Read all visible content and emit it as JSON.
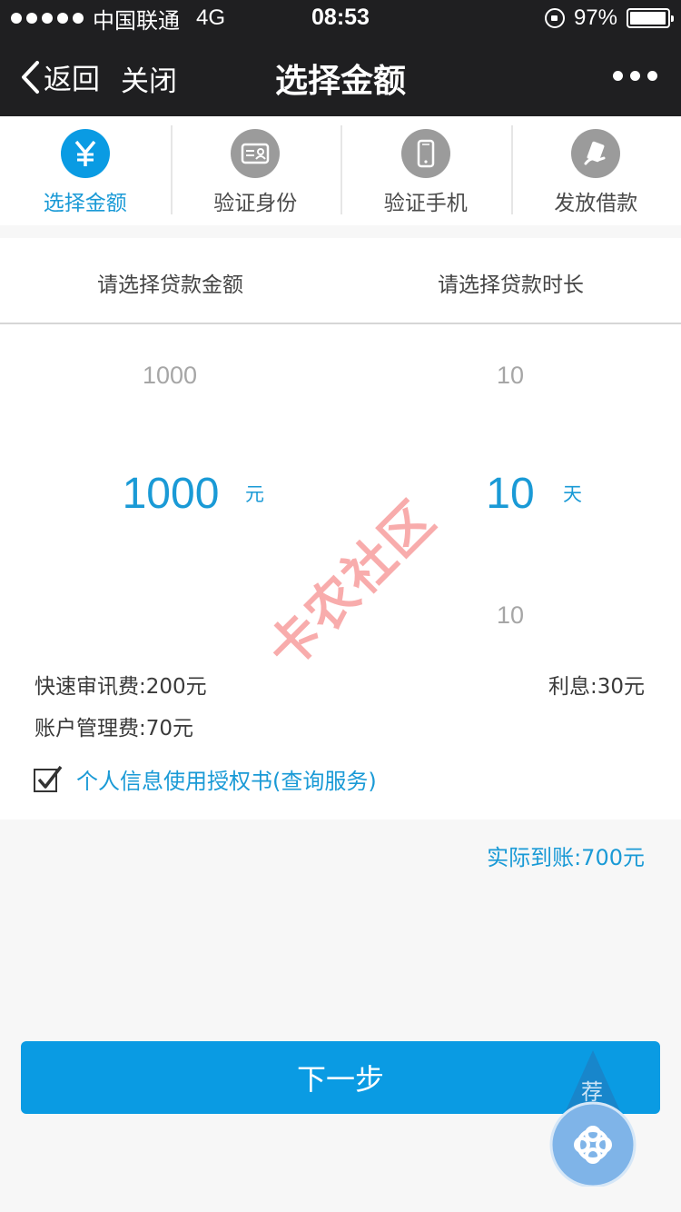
{
  "status_bar": {
    "carrier": "中国联通",
    "network": "4G",
    "time": "08:53",
    "battery": "97%",
    "battery_level": 0.97
  },
  "nav": {
    "back_label": "返回",
    "close_label": "关闭",
    "title": "选择金额"
  },
  "steps": [
    {
      "label": "选择金额",
      "icon": "yuan-icon",
      "active": true
    },
    {
      "label": "验证身份",
      "icon": "id-card-icon",
      "active": false
    },
    {
      "label": "验证手机",
      "icon": "phone-icon",
      "active": false
    },
    {
      "label": "发放借款",
      "icon": "money-icon",
      "active": false
    }
  ],
  "amount_picker": {
    "header": "请选择贷款金额",
    "above": "1000",
    "selected": "1000",
    "unit": "元"
  },
  "term_picker": {
    "header": "请选择贷款时长",
    "above": "10",
    "selected": "10",
    "unit": "天",
    "below": "10"
  },
  "fees": {
    "review_fee": "快速审讯费:200元",
    "account_fee": "账户管理费:70元",
    "interest": "利息:30元"
  },
  "agreement": {
    "checked": true,
    "label": "个人信息使用授权书(查询服务)"
  },
  "received": "实际到账:700元",
  "next_button": "下一步",
  "watermark": "卡农社区",
  "float_badge": {
    "label": "荐",
    "icon": "unicom-logo-icon"
  },
  "colors": {
    "accent": "#0a9be3",
    "dark_bar": "#1f1f21",
    "inactive_icon": "#9b9b9b"
  }
}
